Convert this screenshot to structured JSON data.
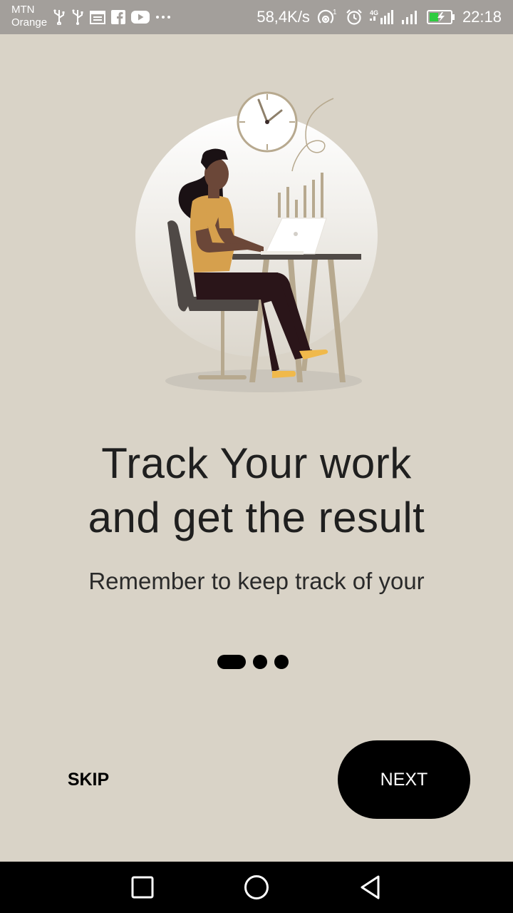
{
  "status_bar": {
    "carrier_line1": "MTN",
    "carrier_line2": "Orange",
    "left_icons": [
      "usb-icon",
      "usb-icon",
      "calendar-icon",
      "facebook-icon",
      "youtube-icon",
      "more-dots-icon"
    ],
    "net_speed": "58,4K/s",
    "right_icons": [
      "hotspot-icon",
      "alarm-icon",
      "signal-4g-icon",
      "signal-icon",
      "battery-charging-icon"
    ],
    "time": "22:18"
  },
  "onboarding": {
    "title_line1": "Track Your work",
    "title_line2": "and get the result",
    "subtitle": "Remember to keep track of your",
    "page_count": 3,
    "active_page": 1
  },
  "actions": {
    "skip_label": "SKIP",
    "next_label": "NEXT"
  },
  "nav_bar": {
    "buttons": [
      "recents-square-icon",
      "home-circle-icon",
      "back-triangle-icon"
    ]
  },
  "colors": {
    "background": "#d9d3c7",
    "status_bar": "#a39f9b",
    "primary": "#000000",
    "accent_yellow": "#e2ab43"
  }
}
